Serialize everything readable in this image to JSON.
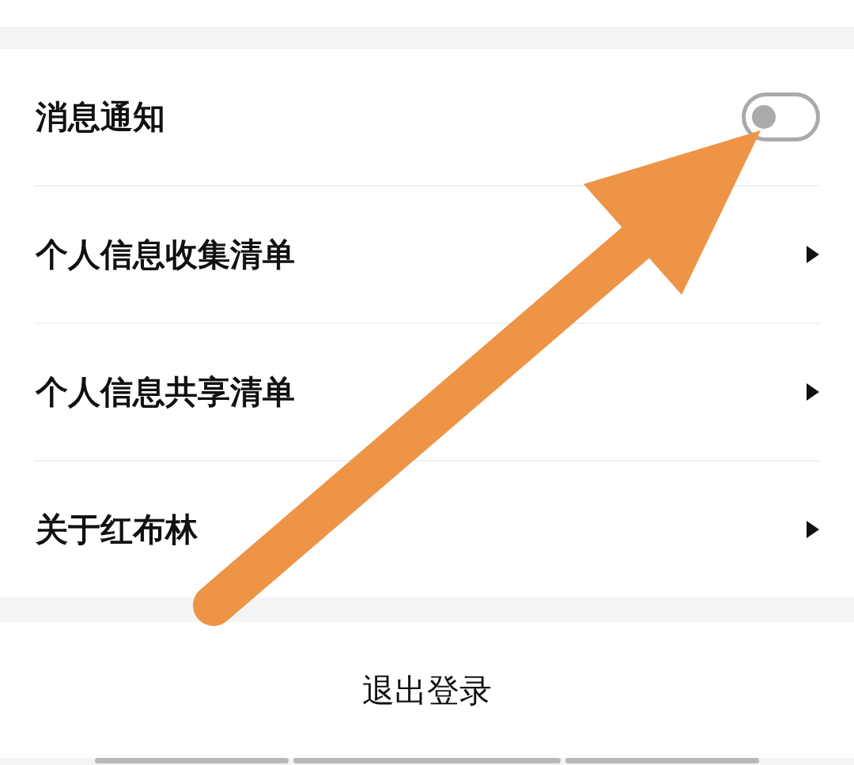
{
  "settings": [
    {
      "kind": "toggle",
      "label": "消息通知",
      "on": false
    },
    {
      "kind": "link",
      "label": "个人信息收集清单"
    },
    {
      "kind": "link",
      "label": "个人信息共享清单"
    },
    {
      "kind": "link",
      "label": "关于红布林"
    }
  ],
  "logout_button": {
    "label": "退出登录"
  }
}
